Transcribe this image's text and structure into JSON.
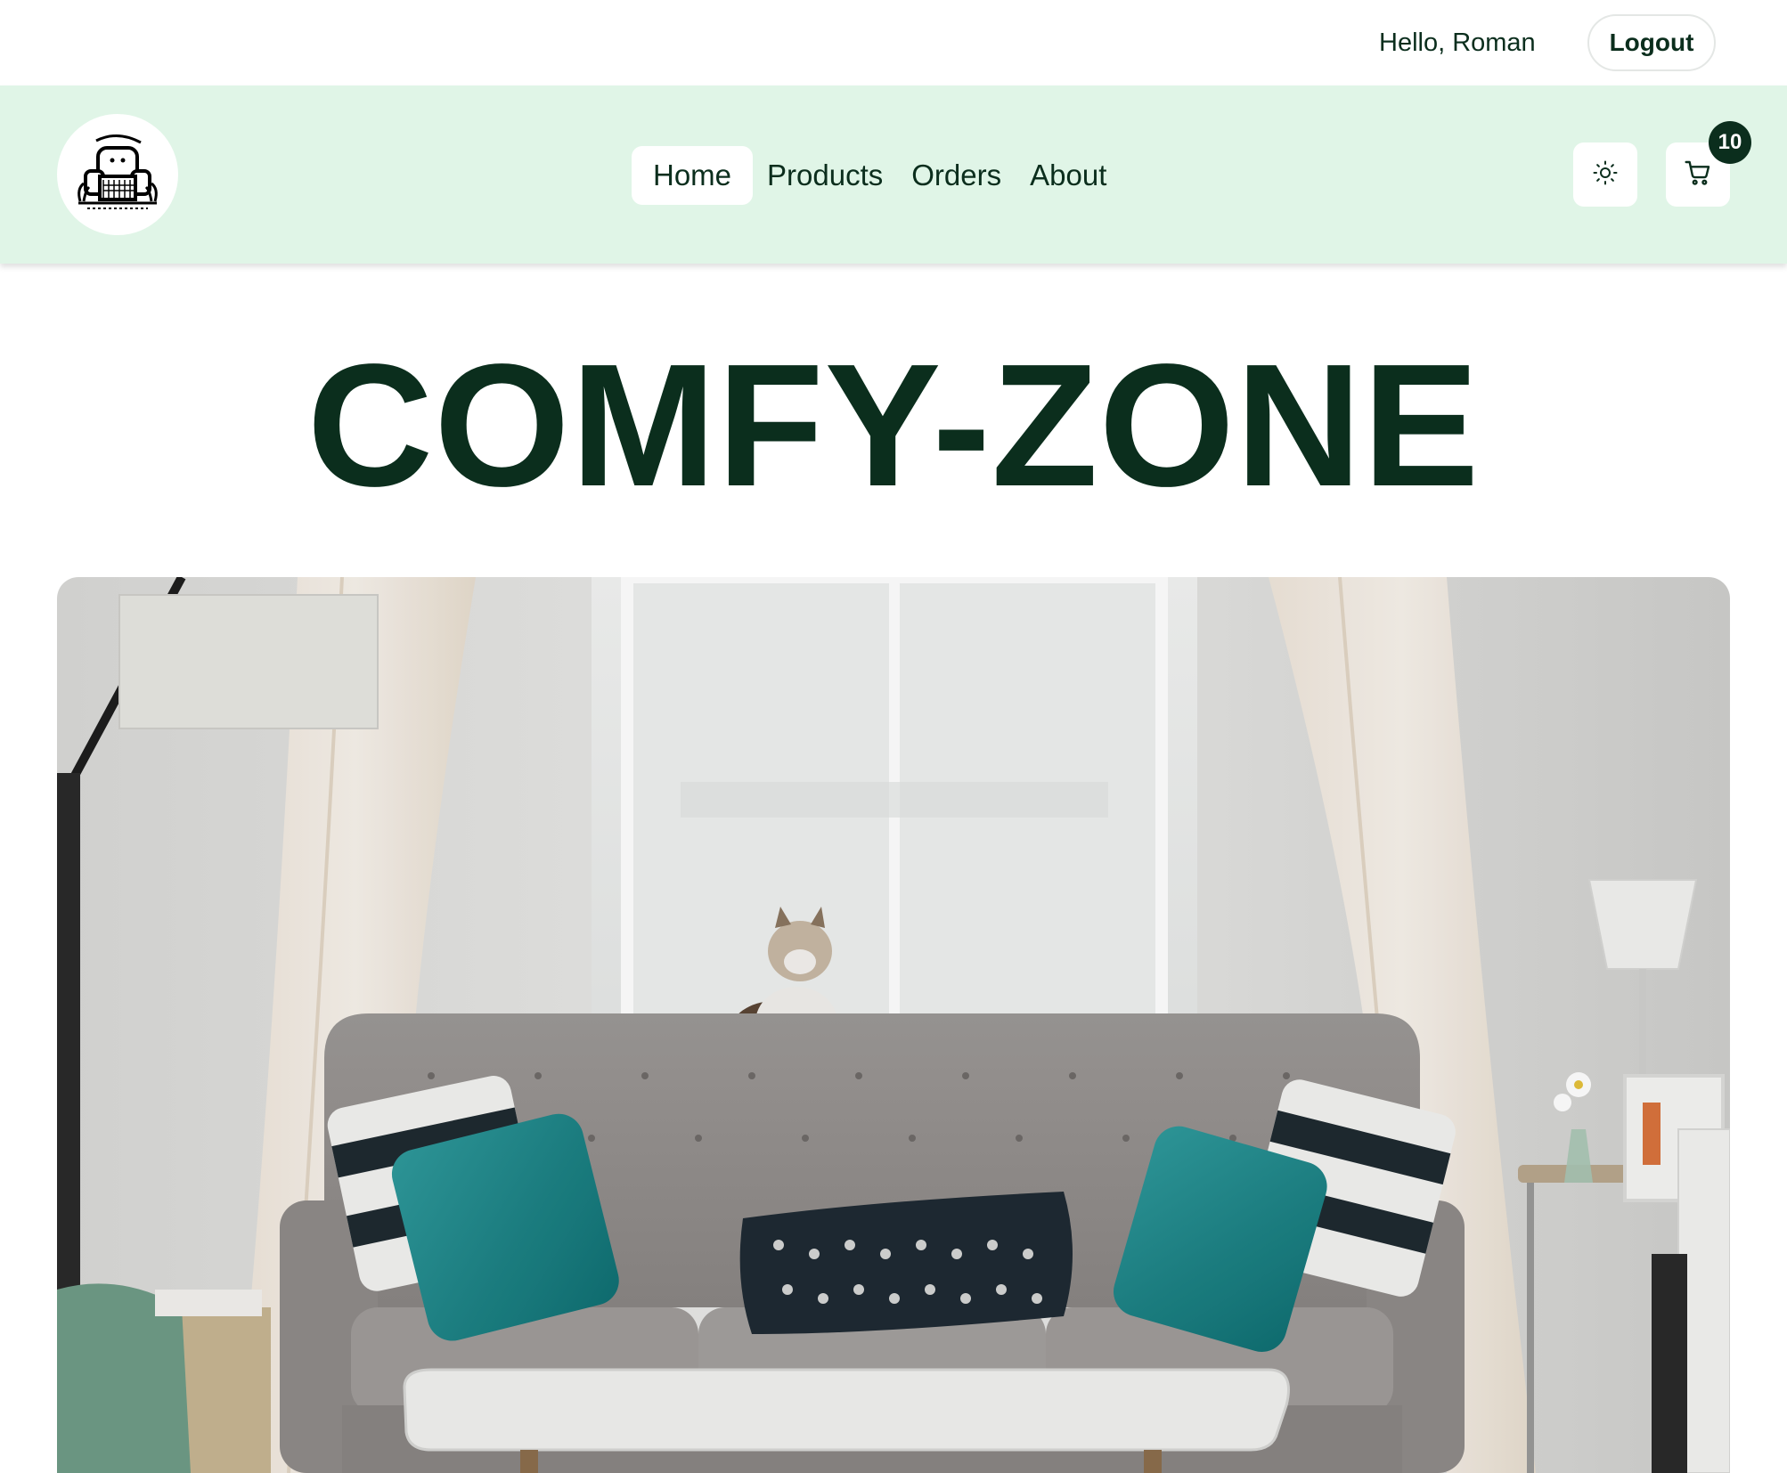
{
  "topbar": {
    "greeting": "Hello, Roman",
    "logout_label": "Logout"
  },
  "navbar": {
    "logo_icon": "armchair-logo-icon",
    "links": [
      {
        "label": "Home",
        "active": true
      },
      {
        "label": "Products",
        "active": false
      },
      {
        "label": "Orders",
        "active": false
      },
      {
        "label": "About",
        "active": false
      }
    ],
    "theme_icon": "sun-icon",
    "cart_icon": "cart-icon",
    "cart_count": "10"
  },
  "hero": {
    "title": "COMFY-ZONE",
    "image": "living-room-sofa-photo"
  },
  "colors": {
    "brand_dark": "#0b2e1d",
    "nav_bg": "#e0f5e7",
    "white": "#ffffff"
  }
}
